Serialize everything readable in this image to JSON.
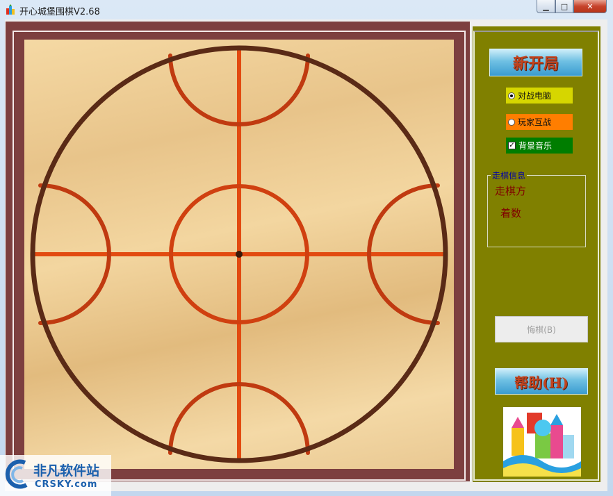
{
  "window": {
    "title": "开心城堡围棋V2.68",
    "controls": {
      "minimize": "▁",
      "maximize": "□",
      "close": "✕"
    }
  },
  "board": {
    "lines_color": "#e24a10",
    "outline_color": "#5a2a16"
  },
  "sidebar": {
    "new_game_label": "新开局",
    "mode_options": [
      {
        "label": "对战电脑",
        "selected": true
      },
      {
        "label": "玩家互战",
        "selected": false
      }
    ],
    "music": {
      "label": "背景音乐",
      "checked": true
    },
    "info_group": {
      "title": "走棋信息",
      "turn_label": "走棋方",
      "moves_label": "着数"
    },
    "undo_label": "悔棋(B)",
    "help_label": "帮助(H)"
  },
  "watermark": {
    "cn": "非凡软件站",
    "en": "CRSKY.com"
  }
}
